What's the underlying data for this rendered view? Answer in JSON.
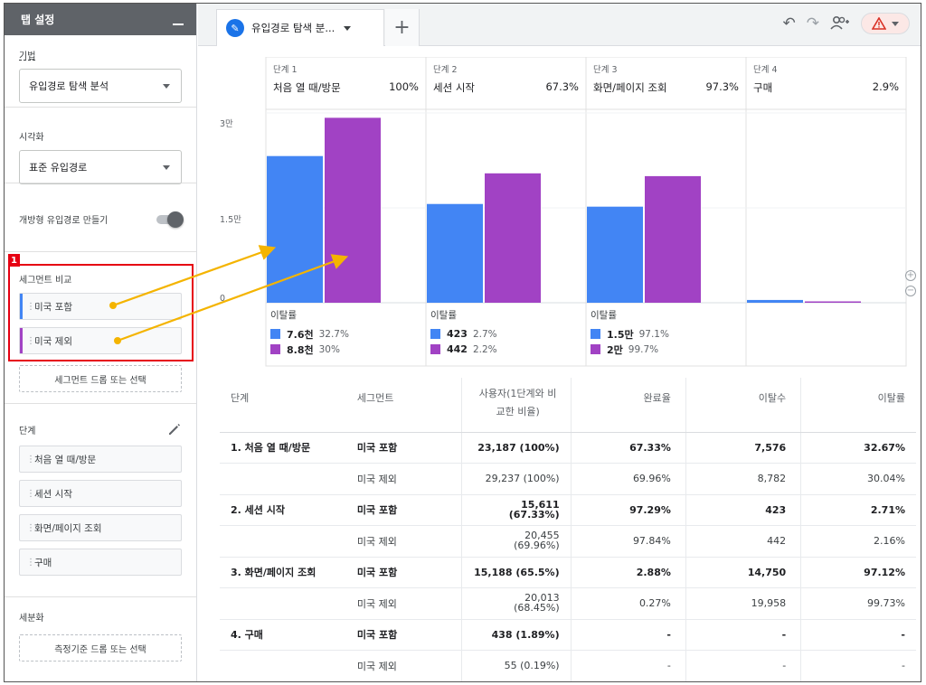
{
  "left_panel": {
    "header_title": "탭 설정",
    "technique_label": "기법",
    "technique_value": "유입경로 탐색 분석",
    "visualization_label": "시각화",
    "visualization_value": "표준 유입경로",
    "open_funnel_label": "개방형 유입경로 만들기",
    "segment_compare_label": "세그먼트 비교",
    "segments": [
      {
        "label": "미국 포함",
        "color": "#4285f4"
      },
      {
        "label": "미국 제외",
        "color": "#a142c4"
      }
    ],
    "segment_drop_label": "세그먼트 드롭 또는 선택",
    "steps_label": "단계",
    "steps": [
      "처음 열 때/방문",
      "세션 시작",
      "화면/페이지 조회",
      "구매"
    ],
    "breakdown_label": "세분화",
    "dimension_drop_label": "측정기준 드롭 또는 선택",
    "annotation_number": "1"
  },
  "tabbar": {
    "tab_title": "유입경로 탐색 분...",
    "add_tab": "+",
    "warning_icon": "warning-icon"
  },
  "chart_data": {
    "type": "bar",
    "categories": [
      "처음 열 때/방문",
      "세션 시작",
      "화면/페이지 조회",
      "구매"
    ],
    "step_labels": [
      "단계 1",
      "단계 2",
      "단계 3",
      "단계 4"
    ],
    "step_percents": [
      "100%",
      "67.3%",
      "97.3%",
      "2.9%"
    ],
    "series": [
      {
        "name": "미국 포함",
        "color": "#4285f4",
        "values": [
          23187,
          15611,
          15188,
          438
        ]
      },
      {
        "name": "미국 제외",
        "color": "#a142c4",
        "values": [
          29237,
          20455,
          20013,
          55
        ]
      }
    ],
    "yticks": [
      "3만",
      "1.5만",
      "0"
    ],
    "ylim": [
      0,
      30000
    ],
    "dropoff_label": "이탈률",
    "dropoffs": [
      [
        {
          "value": "7.6천",
          "pct": "32.7%"
        },
        {
          "value": "8.8천",
          "pct": "30%"
        }
      ],
      [
        {
          "value": "423",
          "pct": "2.7%"
        },
        {
          "value": "442",
          "pct": "2.2%"
        }
      ],
      [
        {
          "value": "1.5만",
          "pct": "97.1%"
        },
        {
          "value": "2만",
          "pct": "99.7%"
        }
      ]
    ]
  },
  "table": {
    "headers": [
      "단계",
      "세그먼트",
      "사용자(1단계와 비교한 비율)",
      "완료율",
      "이탈수",
      "이탈률"
    ],
    "rows": [
      {
        "step": "1. 처음 열 때/방문",
        "segment": "미국 포함",
        "users": "23,187 (100%)",
        "completion": "67.33%",
        "abandon": "7,576",
        "abandon_rate": "32.67%"
      },
      {
        "step": "",
        "segment": "미국 제외",
        "users": "29,237 (100%)",
        "completion": "69.96%",
        "abandon": "8,782",
        "abandon_rate": "30.04%"
      },
      {
        "step": "2. 세션 시작",
        "segment": "미국 포함",
        "users_l1": "15,611",
        "users_l2": "(67.33%)",
        "completion": "97.29%",
        "abandon": "423",
        "abandon_rate": "2.71%"
      },
      {
        "step": "",
        "segment": "미국 제외",
        "users_l1": "20,455",
        "users_l2": "(69.96%)",
        "completion": "97.84%",
        "abandon": "442",
        "abandon_rate": "2.16%"
      },
      {
        "step": "3. 화면/페이지 조회",
        "segment": "미국 포함",
        "users": "15,188 (65.5%)",
        "completion": "2.88%",
        "abandon": "14,750",
        "abandon_rate": "97.12%"
      },
      {
        "step": "",
        "segment": "미국 제외",
        "users_l1": "20,013",
        "users_l2": "(68.45%)",
        "completion": "0.27%",
        "abandon": "19,958",
        "abandon_rate": "99.73%"
      },
      {
        "step": "4. 구매",
        "segment": "미국 포함",
        "users": "438 (1.89%)",
        "completion": "-",
        "abandon": "-",
        "abandon_rate": "-"
      },
      {
        "step": "",
        "segment": "미국 제외",
        "users": "55 (0.19%)",
        "completion": "-",
        "abandon": "-",
        "abandon_rate": "-"
      }
    ]
  }
}
